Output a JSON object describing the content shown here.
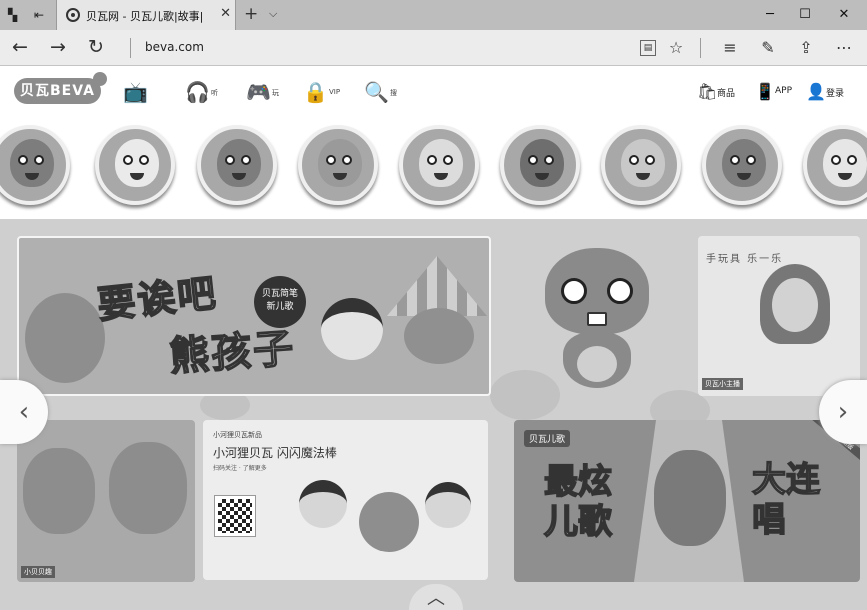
{
  "browser": {
    "tab_title": "贝瓦网 - 贝瓦儿歌|故事|",
    "tab_close": "✕",
    "new_tab": "+",
    "tab_menu": "⌵",
    "url": "beva.com",
    "window": {
      "minimize": "─",
      "maximize": "☐",
      "close": "✕"
    }
  },
  "site": {
    "logo_text": "贝瓦BEVA",
    "nav": [
      {
        "icon": "tv-icon",
        "glyph": "📺",
        "label": ""
      },
      {
        "icon": "headphones-icon",
        "glyph": "🎧",
        "label": "听"
      },
      {
        "icon": "gamepad-icon",
        "glyph": "🎮",
        "label": "玩"
      },
      {
        "icon": "lock-icon",
        "glyph": "🔒",
        "label": "VIP"
      },
      {
        "icon": "search-icon",
        "glyph": "🔍",
        "label": "搜"
      }
    ],
    "right": [
      {
        "icon": "shopping-bag-icon",
        "glyph": "🛍",
        "label": "商品"
      },
      {
        "icon": "phone-icon",
        "glyph": "📱",
        "label": "APP"
      },
      {
        "icon": "user-icon",
        "glyph": "👤",
        "label": "登录"
      }
    ]
  },
  "banners": {
    "main_title_1": "要诶吧",
    "main_title_2": "熊孩子",
    "main_badge": "贝瓦简笔\n新儿歌",
    "right_top_handwriting": "手玩具 乐一乐",
    "right_top_caption": "贝瓦小主播",
    "bottom_left_caption": "小贝贝趣",
    "bottom_center_small": "小河狸贝瓦新品",
    "bottom_center_headline": "小河狸贝瓦 闪闪魔法棒",
    "bottom_center_desc": "扫码关注 · 了解更多",
    "bottom_right_tag": "贝瓦儿歌",
    "bottom_right_title_1": "最炫\n儿歌",
    "bottom_right_title_2": "大连\n唱",
    "bottom_right_ribbon": "贝瓦儿歌新版"
  },
  "controls": {
    "prev": "‹",
    "next": "›",
    "up": "︿"
  }
}
